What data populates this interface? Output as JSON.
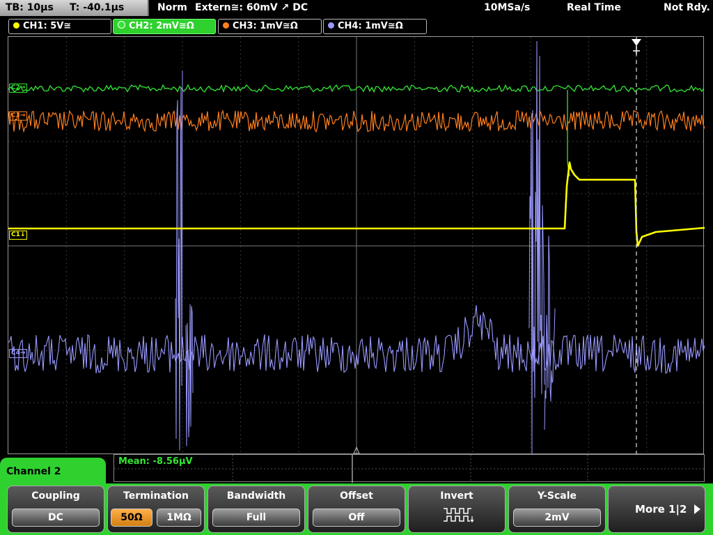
{
  "topbar": {
    "timebase": "TB: 10µs",
    "trigger_time": "T: -40.1µs",
    "trigger_mode": "Norm",
    "trigger_source": "Extern≅: 60mV ↗ DC",
    "sample_rate": "10MSa/s",
    "acquisition": "Real Time",
    "status": "Not Rdy."
  },
  "channels": [
    {
      "label": "CH1: 5V≅",
      "color": "#ffff00",
      "active": false
    },
    {
      "label": "CH2: 2mV≅Ω",
      "color": "#33e633",
      "active": true
    },
    {
      "label": "CH3: 1mV≅Ω",
      "color": "#ff7f1e",
      "active": false
    },
    {
      "label": "CH4: 1mV≅Ω",
      "color": "#9999ff",
      "active": false
    }
  ],
  "markers": {
    "ch2": "C2→",
    "ch3": "C3→",
    "ch1": "C1↓",
    "ch4": "C4→"
  },
  "measurement": {
    "text": "Mean: -8.56µV"
  },
  "menu": {
    "title": "Channel 2",
    "coupling": {
      "label": "Coupling",
      "value": "DC"
    },
    "termination": {
      "label": "Termination",
      "options": [
        "50Ω",
        "1MΩ"
      ],
      "selected": "50Ω"
    },
    "bandwidth": {
      "label": "Bandwidth",
      "value": "Full"
    },
    "offset": {
      "label": "Offset",
      "value": "Off"
    },
    "invert": {
      "label": "Invert",
      "icon": "invert-waveform-icon"
    },
    "yscale": {
      "label": "Y-Scale",
      "value": "2mV"
    },
    "more": {
      "label": "More 1|2"
    }
  },
  "colors": {
    "ch1": "#ffff00",
    "ch2": "#33e633",
    "ch3": "#ff7f1e",
    "ch4": "#9999ff",
    "menu_accent": "#2fd12f",
    "softkey_selected": "#f0a030"
  }
}
